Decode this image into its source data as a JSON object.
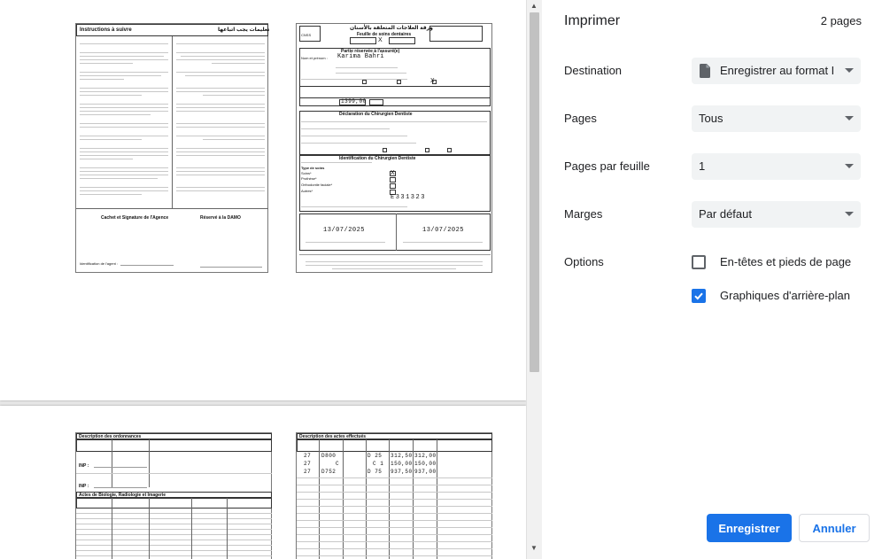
{
  "panel": {
    "title": "Imprimer",
    "page_count": "2 pages",
    "destination": {
      "label": "Destination",
      "value": "Enregistrer au format PDF"
    },
    "pages": {
      "label": "Pages",
      "value": "Tous"
    },
    "pages_per_sheet": {
      "label": "Pages par feuille",
      "value": "1"
    },
    "margins": {
      "label": "Marges",
      "value": "Par défaut"
    },
    "options": {
      "label": "Options",
      "headers_footers": {
        "label": "En-têtes et pieds de page",
        "checked": false
      },
      "background_graphics": {
        "label": "Graphiques d'arrière-plan",
        "checked": true
      }
    },
    "save_label": "Enregistrer",
    "cancel_label": "Annuler",
    "accent_color": "#1a73e8"
  },
  "preview": {
    "left_page": {
      "title": "Instructions à suivre",
      "title_ar": "تعليمات يجب اتباعها",
      "stamp_fr": "Cachet et Signature de l'Agence",
      "stamp_fr2": "Réservé à la DAMO",
      "ident_label": "Identification de l'agent :"
    },
    "right_page": {
      "header_title_fr": "Feuille de soins dentaires",
      "header_title_ar": "ورقة العلاجات المتعلقة بالأسنان",
      "insured_section": "Partie réservée à l'assuré(e)",
      "name_label": "Nom et prénom :",
      "name_value": "Karima Bahri",
      "declaration_section": "Déclaration du Chirurgien Dentiste",
      "identification_section": "Identification du Chirurgien Dentiste",
      "type_of_care": "Type de soins",
      "amount_value": "1399,00",
      "inpe_value": "E331323",
      "date1": "13/07/2025",
      "date2": "13/07/2025",
      "prothese_label": "Prothèse*",
      "orthodontie_label": "Orthodontie faciale*",
      "soins_label": "Soins*",
      "autres_label": "Autres*"
    },
    "bottom_left": {
      "section1": "Description des ordonnances",
      "section2": "Actes de Biologie, Radiologie et Imagerie",
      "inp1": "INP :",
      "inp2": "INP :"
    },
    "bottom_right": {
      "section": "Description des actes effectués",
      "rows": [
        {
          "date": "27",
          "code": "D800",
          "coef": "D 25",
          "value": "312,50",
          "total": "312,00"
        },
        {
          "date": "27",
          "code": "C",
          "coef": "C 1",
          "value": "150,00",
          "total": "150,00"
        },
        {
          "date": "27",
          "code": "D752",
          "coef": "D 75",
          "value": "937,50",
          "total": "937,00"
        }
      ]
    }
  }
}
